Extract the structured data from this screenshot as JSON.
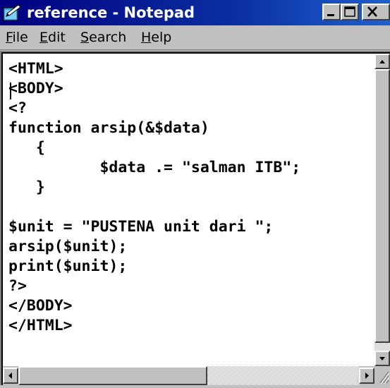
{
  "window": {
    "title": "reference - Notepad",
    "app_icon": "notepad-icon"
  },
  "title_buttons": {
    "minimize_icon": "minimize-icon",
    "maximize_icon": "maximize-icon",
    "close_icon": "close-icon"
  },
  "menu": {
    "items": [
      {
        "label_ul": "F",
        "label_rest": "ile"
      },
      {
        "label_ul": "E",
        "label_rest": "dit"
      },
      {
        "label_ul": "S",
        "label_rest": "earch"
      },
      {
        "label_ul": "H",
        "label_rest": "elp"
      }
    ]
  },
  "editor": {
    "lines": [
      "<HTML>",
      "<BODY>",
      "<?",
      "function arsip(&$data)",
      "   {",
      "          $data .= \"salman ITB\";",
      "   }",
      "",
      "$unit = \"PUSTENA unit dari \";",
      "arsip($unit);",
      "print($unit);",
      "?>",
      "</BODY>",
      "</HTML>"
    ]
  },
  "scrollbars": {
    "up_icon": "arrow-up-icon",
    "down_icon": "arrow-down-icon",
    "left_icon": "arrow-left-icon",
    "right_icon": "arrow-right-icon",
    "grip_icon": "resize-grip-icon"
  },
  "colors": {
    "title_bar": "#000080",
    "window_face": "#c0c0c0",
    "editor_bg": "#ffffff"
  }
}
